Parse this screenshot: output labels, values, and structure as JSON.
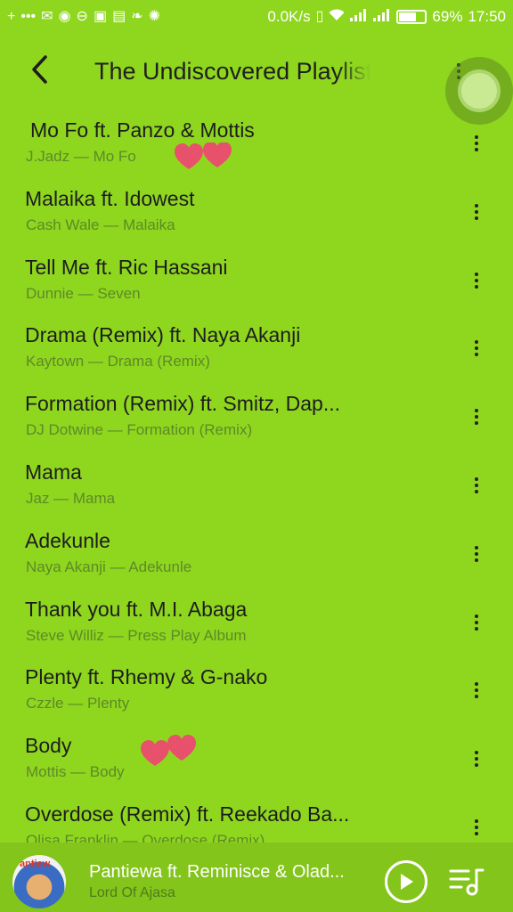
{
  "status_bar": {
    "network_speed": "0.0K/s",
    "battery_percent": "69%",
    "battery_level": 0.69,
    "time": "17:50",
    "left_icons": [
      "plus-icon",
      "more-dots-icon",
      "mail-icon",
      "app-icon",
      "minus-circle-icon",
      "facebook-icon",
      "settings-icon",
      "chat-icon",
      "wind-icon"
    ],
    "right_icons": [
      "vibrate-icon",
      "wifi-icon",
      "signal-icon",
      "signal-icon",
      "battery-icon"
    ]
  },
  "header": {
    "title": "The Undiscovered Playlist"
  },
  "tracks": [
    {
      "title": "Mo Fo ft. Panzo & Mottis",
      "subtitle": "J.Jadz — Mo Fo"
    },
    {
      "title": "Malaika ft. Idowest",
      "subtitle": "Cash Wale — Malaika"
    },
    {
      "title": "Tell Me ft. Ric Hassani",
      "subtitle": "Dunnie — Seven"
    },
    {
      "title": "Drama (Remix) ft. Naya Akanji",
      "subtitle": "Kaytown — Drama (Remix)"
    },
    {
      "title": "Formation (Remix) ft. Smitz, Dap...",
      "subtitle": "DJ Dotwine — Formation (Remix)"
    },
    {
      "title": "Mama",
      "subtitle": "Jaz — Mama"
    },
    {
      "title": "Adekunle",
      "subtitle": "Naya Akanji — Adekunle"
    },
    {
      "title": "Thank you ft. M.I. Abaga",
      "subtitle": "Steve Williz — Press Play Album"
    },
    {
      "title": "Plenty ft. Rhemy &  G-nako",
      "subtitle": "Czzle — Plenty"
    },
    {
      "title": "Body",
      "subtitle": "Mottis — Body"
    },
    {
      "title": "Overdose (Remix) ft. Reekado Ba...",
      "subtitle": "Olisa Franklin — Overdose (Remix)"
    }
  ],
  "now_playing": {
    "title": "Pantiewa ft. Reminisce & Olad...",
    "subtitle": "Lord Of Ajasa",
    "art_label": "antiew"
  },
  "colors": {
    "background": "#8fd61f",
    "player_bar": "#83c51a",
    "subtitle": "#5d8a27",
    "heart": "#e8516b"
  }
}
